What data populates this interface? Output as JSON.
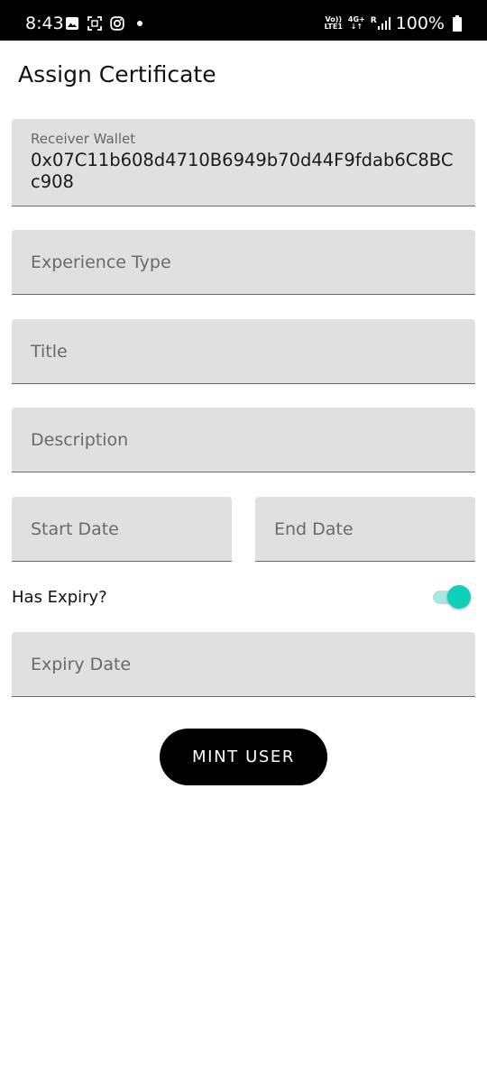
{
  "status_bar": {
    "time": "8:43",
    "left_icons": [
      "gallery-icon",
      "screenshot-icon",
      "instagram-icon",
      "notification-dot-icon"
    ],
    "volte_top": "Vo))",
    "volte_bottom": "LTE1",
    "network_top": "4G+",
    "network_bottom": "↓↑",
    "roaming": "R",
    "battery_percent": "100%"
  },
  "page": {
    "title": "Assign Certificate"
  },
  "form": {
    "receiver_wallet": {
      "label": "Receiver Wallet",
      "value": "0x07C11b608d4710B6949b70d44F9fdab6C8BCc908"
    },
    "experience_type": {
      "placeholder": "Experience Type"
    },
    "title": {
      "placeholder": "Title"
    },
    "description": {
      "placeholder": "Description"
    },
    "start_date": {
      "placeholder": "Start Date"
    },
    "end_date": {
      "placeholder": "End Date"
    },
    "has_expiry": {
      "label": "Has Expiry?",
      "checked": true
    },
    "expiry_date": {
      "placeholder": "Expiry Date"
    },
    "submit_label": "MINT USER"
  },
  "colors": {
    "accent": "#0fcfbb",
    "field_bg": "#e0e0e0",
    "button_bg": "#000000"
  }
}
